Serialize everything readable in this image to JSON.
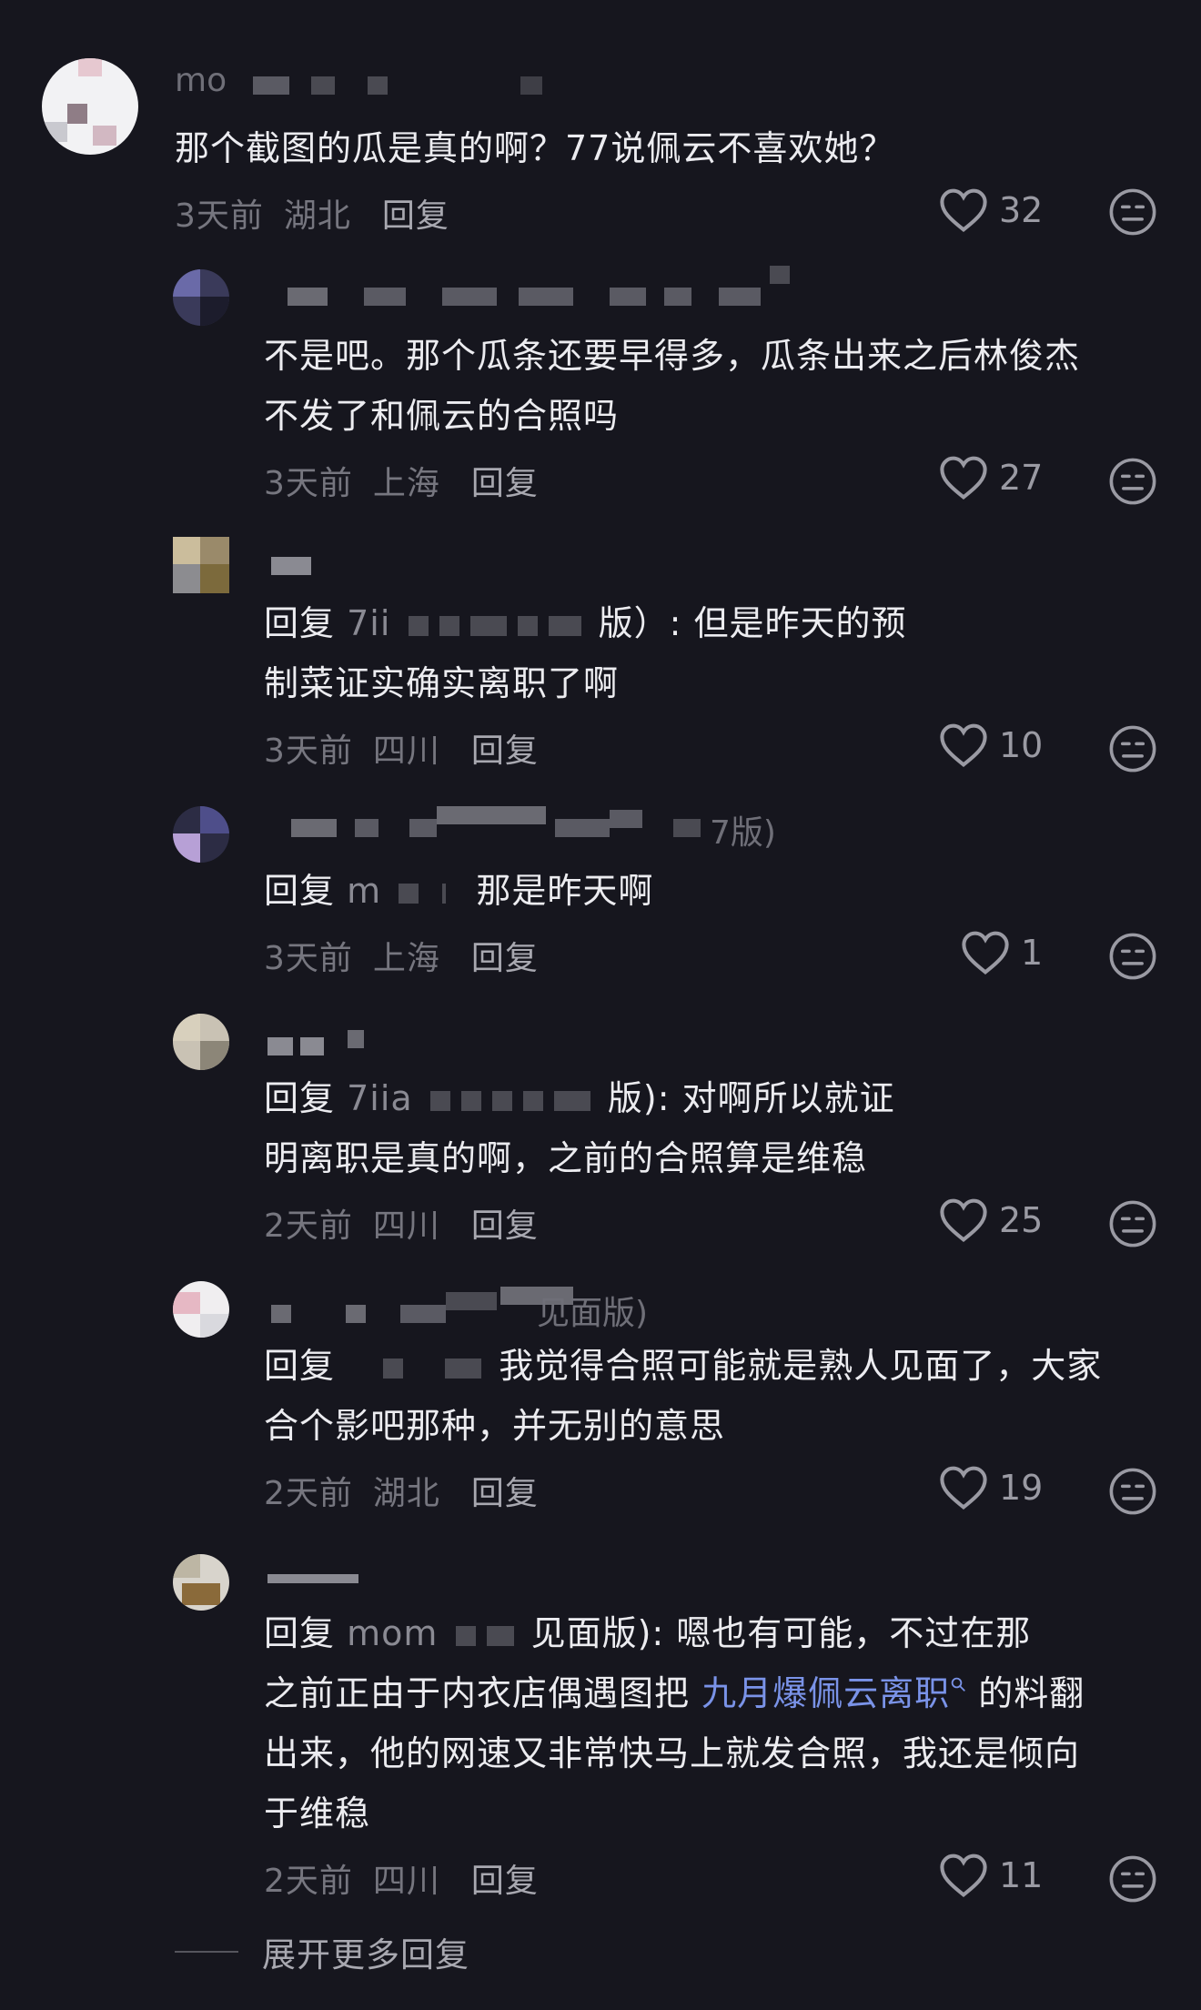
{
  "top_comment": {
    "username": "mo",
    "text": "那个截图的瓜是真的啊？77说佩云不喜欢她？",
    "time": "3天前",
    "location": "湖北",
    "reply_label": "回复",
    "likes": "32"
  },
  "replies": [
    {
      "text": "不是吧。那个瓜条还要早得多，瓜条出来之后林俊杰",
      "text2": "不发了和佩云的合照吗",
      "time": "3天前",
      "location": "上海",
      "reply_label": "回复",
      "likes": "27"
    },
    {
      "prefix": "回复",
      "at": "7ii",
      "tail": "版）: 但是昨天的预",
      "text2": "制菜证实确实离职了啊",
      "time": "3天前",
      "location": "四川",
      "reply_label": "回复",
      "likes": "10"
    },
    {
      "name_tail": "7版)",
      "prefix": "回复",
      "at": "m",
      "tail": "那是昨天啊",
      "time": "3天前",
      "location": "上海",
      "reply_label": "回复",
      "likes": "1"
    },
    {
      "prefix": "回复",
      "at": "7iia",
      "tail": "版): 对啊所以就证",
      "text2": "明离职是真的啊，之前的合照算是维稳",
      "time": "2天前",
      "location": "四川",
      "reply_label": "回复",
      "likes": "25"
    },
    {
      "name_tail": "见面版)",
      "prefix": "回复",
      "tail": "我觉得合照可能就是熟人见面了，大家",
      "text2": "合个影吧那种，并无别的意思",
      "time": "2天前",
      "location": "湖北",
      "reply_label": "回复",
      "likes": "19"
    },
    {
      "prefix": "回复",
      "at": "mom",
      "tail": "见面版): 嗯也有可能，不过在那",
      "text2_a": "之前正由于内衣店偶遇图把",
      "link": "九月爆佩云离职",
      "text2_b": "的料翻",
      "text3": "出来，他的网速又非常快马上就发合照，我还是倾向",
      "text4": "于维稳",
      "time": "2天前",
      "location": "四川",
      "reply_label": "回复",
      "likes": "11"
    }
  ],
  "expand_more": "展开更多回复",
  "colors": {
    "background": "#16161e",
    "link": "#7a93e8",
    "meta": "#76767f"
  },
  "icons": {
    "like": "heart-outline-icon",
    "react": "neutral-face-icon",
    "search": "search-icon"
  }
}
